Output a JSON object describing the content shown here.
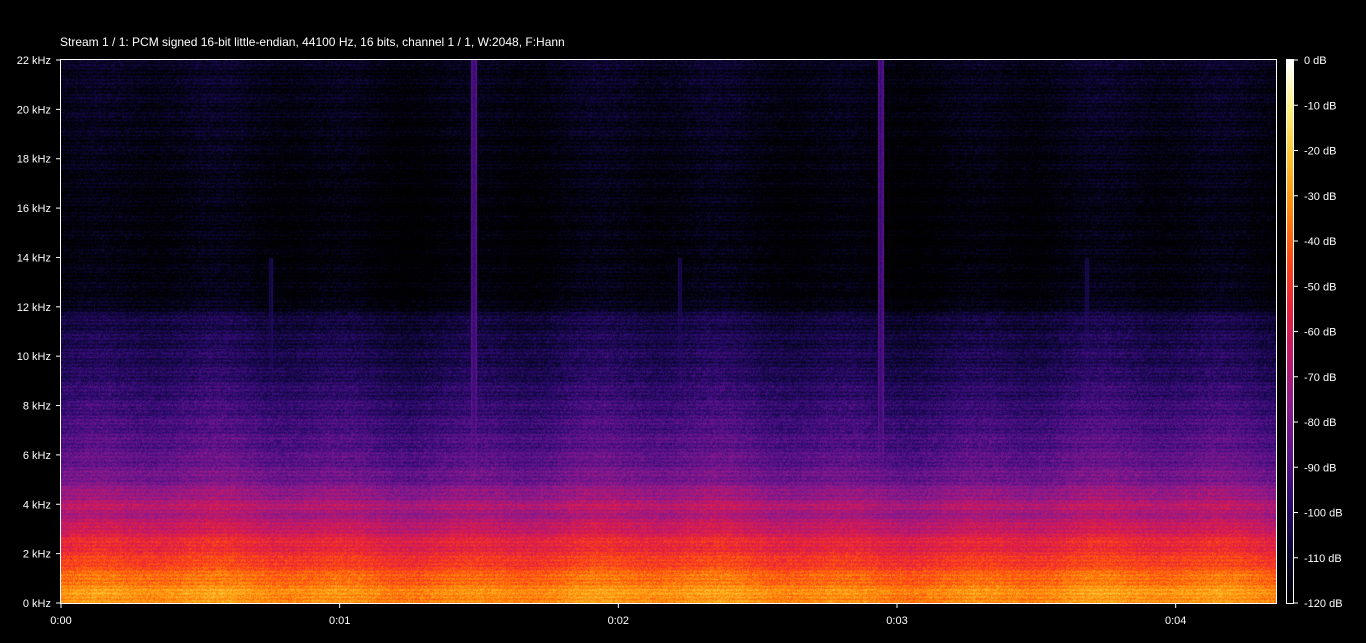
{
  "chart_data": {
    "type": "heatmap",
    "title": "Stream 1 / 1: PCM signed 16-bit little-endian, 44100 Hz, 16 bits, channel 1 / 1, W:2048, F:Hann",
    "y_axis": {
      "ticks": [
        "0 kHz",
        "2 kHz",
        "4 kHz",
        "6 kHz",
        "8 kHz",
        "10 kHz",
        "12 kHz",
        "14 kHz",
        "16 kHz",
        "18 kHz",
        "20 kHz",
        "22 kHz"
      ],
      "values_khz": [
        0,
        2,
        4,
        6,
        8,
        10,
        12,
        14,
        16,
        18,
        20,
        22
      ],
      "range_khz": [
        0,
        22
      ]
    },
    "x_axis": {
      "ticks": [
        "0:00",
        "0:01",
        "0:02",
        "0:03",
        "0:04"
      ],
      "values_s": [
        0,
        1,
        2,
        3,
        4
      ],
      "range_s": [
        0,
        4.36
      ]
    },
    "colorbar": {
      "ticks": [
        "0 dB",
        "-10 dB",
        "-20 dB",
        "-30 dB",
        "-40 dB",
        "-50 dB",
        "-60 dB",
        "-70 dB",
        "-80 dB",
        "-90 dB",
        "-100 dB",
        "-110 dB",
        "-120 dB"
      ],
      "values_db": [
        0,
        -10,
        -20,
        -30,
        -40,
        -50,
        -60,
        -70,
        -80,
        -90,
        -100,
        -110,
        -120
      ],
      "range_db": [
        -120,
        0
      ],
      "colors": [
        "#000000",
        "#0a0630",
        "#2a0a6e",
        "#5c128a",
        "#8a1a8c",
        "#c0186a",
        "#e8223a",
        "#ff4a12",
        "#ff8a08",
        "#ffc02a",
        "#fff07a",
        "#ffffff"
      ]
    },
    "frequency_profile": {
      "freq_khz": [
        0,
        0.5,
        1,
        1.5,
        2,
        2.5,
        3,
        3.5,
        4,
        5,
        6,
        7,
        8,
        9,
        9.5,
        10,
        11,
        11.8,
        12,
        14,
        16,
        18,
        20,
        22
      ],
      "level_db": [
        -30,
        -32,
        -38,
        -45,
        -52,
        -55,
        -62,
        -70,
        -68,
        -82,
        -88,
        -92,
        -96,
        -100,
        -103,
        -103,
        -106,
        -108,
        -117,
        -119,
        -119,
        -117,
        -115,
        -114
      ]
    },
    "transient_times_s": [
      1.48,
      2.94
    ],
    "minor_transient_times_s": [
      0.75,
      2.22,
      3.68
    ]
  }
}
